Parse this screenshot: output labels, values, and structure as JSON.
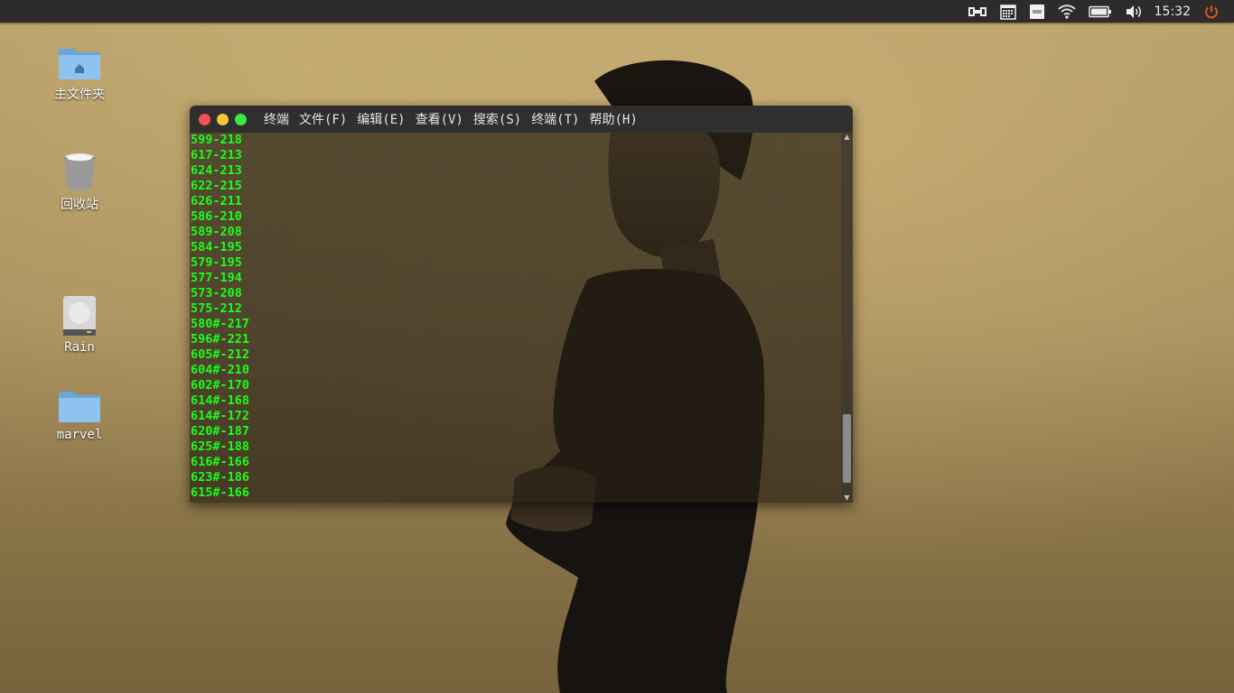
{
  "panel": {
    "clock": "15:32",
    "tray_icons": [
      "input-method-icon",
      "calendar-icon",
      "keyboard-icon",
      "wifi-icon",
      "battery-icon",
      "volume-icon",
      "power-icon"
    ]
  },
  "desktop": {
    "icons": [
      {
        "label": "主文件夹",
        "icon": "home-folder-icon"
      },
      {
        "label": "回收站",
        "icon": "trash-icon"
      },
      {
        "label": "Rain",
        "icon": "drive-icon"
      },
      {
        "label": "marvel",
        "icon": "folder-icon"
      }
    ]
  },
  "terminal": {
    "title": "终端",
    "menu": [
      "文件(F)",
      "编辑(E)",
      "查看(V)",
      "搜索(S)",
      "终端(T)",
      "帮助(H)"
    ],
    "lines": [
      "599-218",
      "617-213",
      "624-213",
      "622-215",
      "626-211",
      "586-210",
      "589-208",
      "584-195",
      "579-195",
      "577-194",
      "573-208",
      "575-212",
      "580#-217",
      "596#-221",
      "605#-212",
      "604#-210",
      "602#-170",
      "614#-168",
      "614#-172",
      "620#-187",
      "625#-188",
      "616#-166",
      "623#-186",
      "615#-166"
    ],
    "text_color": "#19ff19"
  }
}
